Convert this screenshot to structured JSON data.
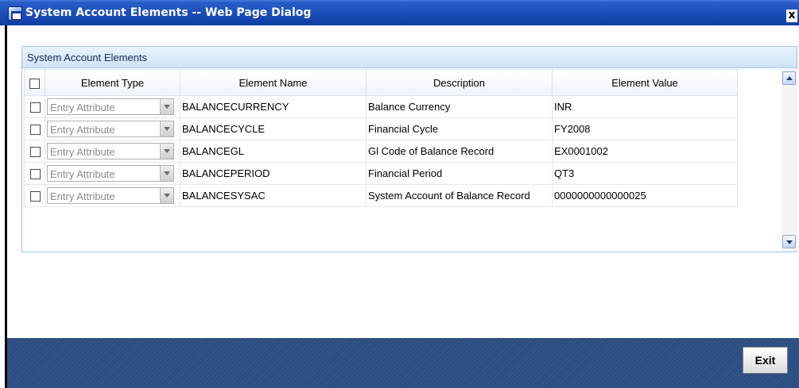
{
  "window": {
    "title": "System Account Elements -- Web Page Dialog",
    "close_label": "x"
  },
  "panel": {
    "title": "System Account Elements"
  },
  "table": {
    "columns": [
      "Element Type",
      "Element Name",
      "Description",
      "Element Value"
    ],
    "rows": [
      {
        "checked": false,
        "type": "Entry Attribute",
        "name": "BALANCECURRENCY",
        "description": "Balance Currency",
        "value": "INR"
      },
      {
        "checked": false,
        "type": "Entry Attribute",
        "name": "BALANCECYCLE",
        "description": "Financial Cycle",
        "value": "FY2008"
      },
      {
        "checked": false,
        "type": "Entry Attribute",
        "name": "BALANCEGL",
        "description": "Gl Code of Balance Record",
        "value": "EX0001002"
      },
      {
        "checked": false,
        "type": "Entry Attribute",
        "name": "BALANCEPERIOD",
        "description": "Financial Period",
        "value": "QT3"
      },
      {
        "checked": false,
        "type": "Entry Attribute",
        "name": "BALANCESYSAC",
        "description": "System Account of Balance Record",
        "value": "0000000000000025"
      }
    ]
  },
  "footer": {
    "exit_label": "Exit"
  },
  "colors": {
    "titlebar": "#1d4fb9",
    "footer": "#2c4d82",
    "panel_header": "#cfe3f6"
  }
}
